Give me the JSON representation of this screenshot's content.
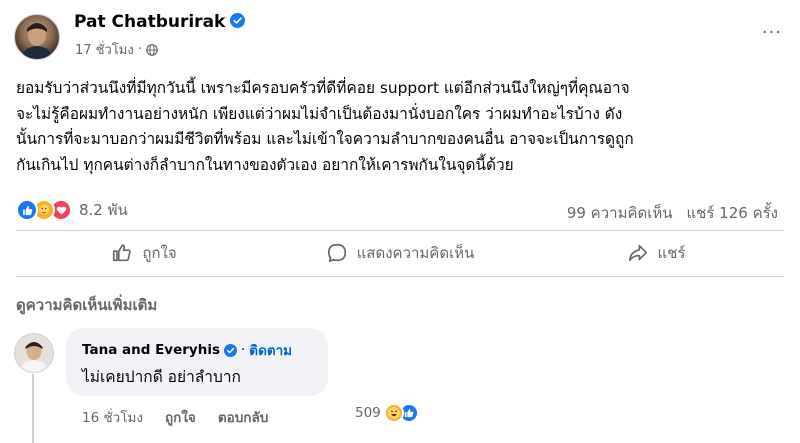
{
  "post": {
    "author": "Pat Chatburirak",
    "time": "17 ชั่วโมง",
    "privacy_sep": "·",
    "more": "···",
    "body_lines": [
      "ยอมรับว่าส่วนนึงที่มีทุกวันนี้ เพราะมีครอบครัวที่ดีที่คอย support แต่อีกส่วนนึงใหญ่ๆที่คุณอาจ",
      "จะไม่รู้คือผมทำงานอย่างหนัก เพียงแต่ว่าผมไม่จำเป็นต้องมานั่งบอกใคร ว่าผมทำอะไรบ้าง ดัง",
      "นั้นการที่จะมาบอกว่าผมมีชีวิตที่พร้อม และไม่เข้าใจความลำบากของคนอื่น อาจจะเป็นการดูถูก",
      "กันเกินไป  ทุกคนต่างก็ลำบากในทางของตัวเอง อยากให้เคารพกันในจุดนี้ด้วย"
    ],
    "reaction_count": "8.2 พัน",
    "comments_count": "99 ความคิดเห็น",
    "shares_count": "แชร์ 126 ครั้ง"
  },
  "actions": {
    "like": "ถูกใจ",
    "comment": "แสดงความคิดเห็น",
    "share": "แชร์"
  },
  "comments_section": {
    "more_label": "ดูความคิดเห็นเพิ่มเติม"
  },
  "comment": {
    "author": "Tana and Everyhis",
    "separator": "·",
    "follow": "ติดตาม",
    "text": "ไม่เคยปากดี อย่าลำบาก",
    "time": "16 ชั่วโมง",
    "like": "ถูกใจ",
    "reply": "ตอบกลับ",
    "reaction_count": "509"
  },
  "colors": {
    "accent": "#1877f2",
    "follow": "#0064d1",
    "muted": "#65676b"
  }
}
